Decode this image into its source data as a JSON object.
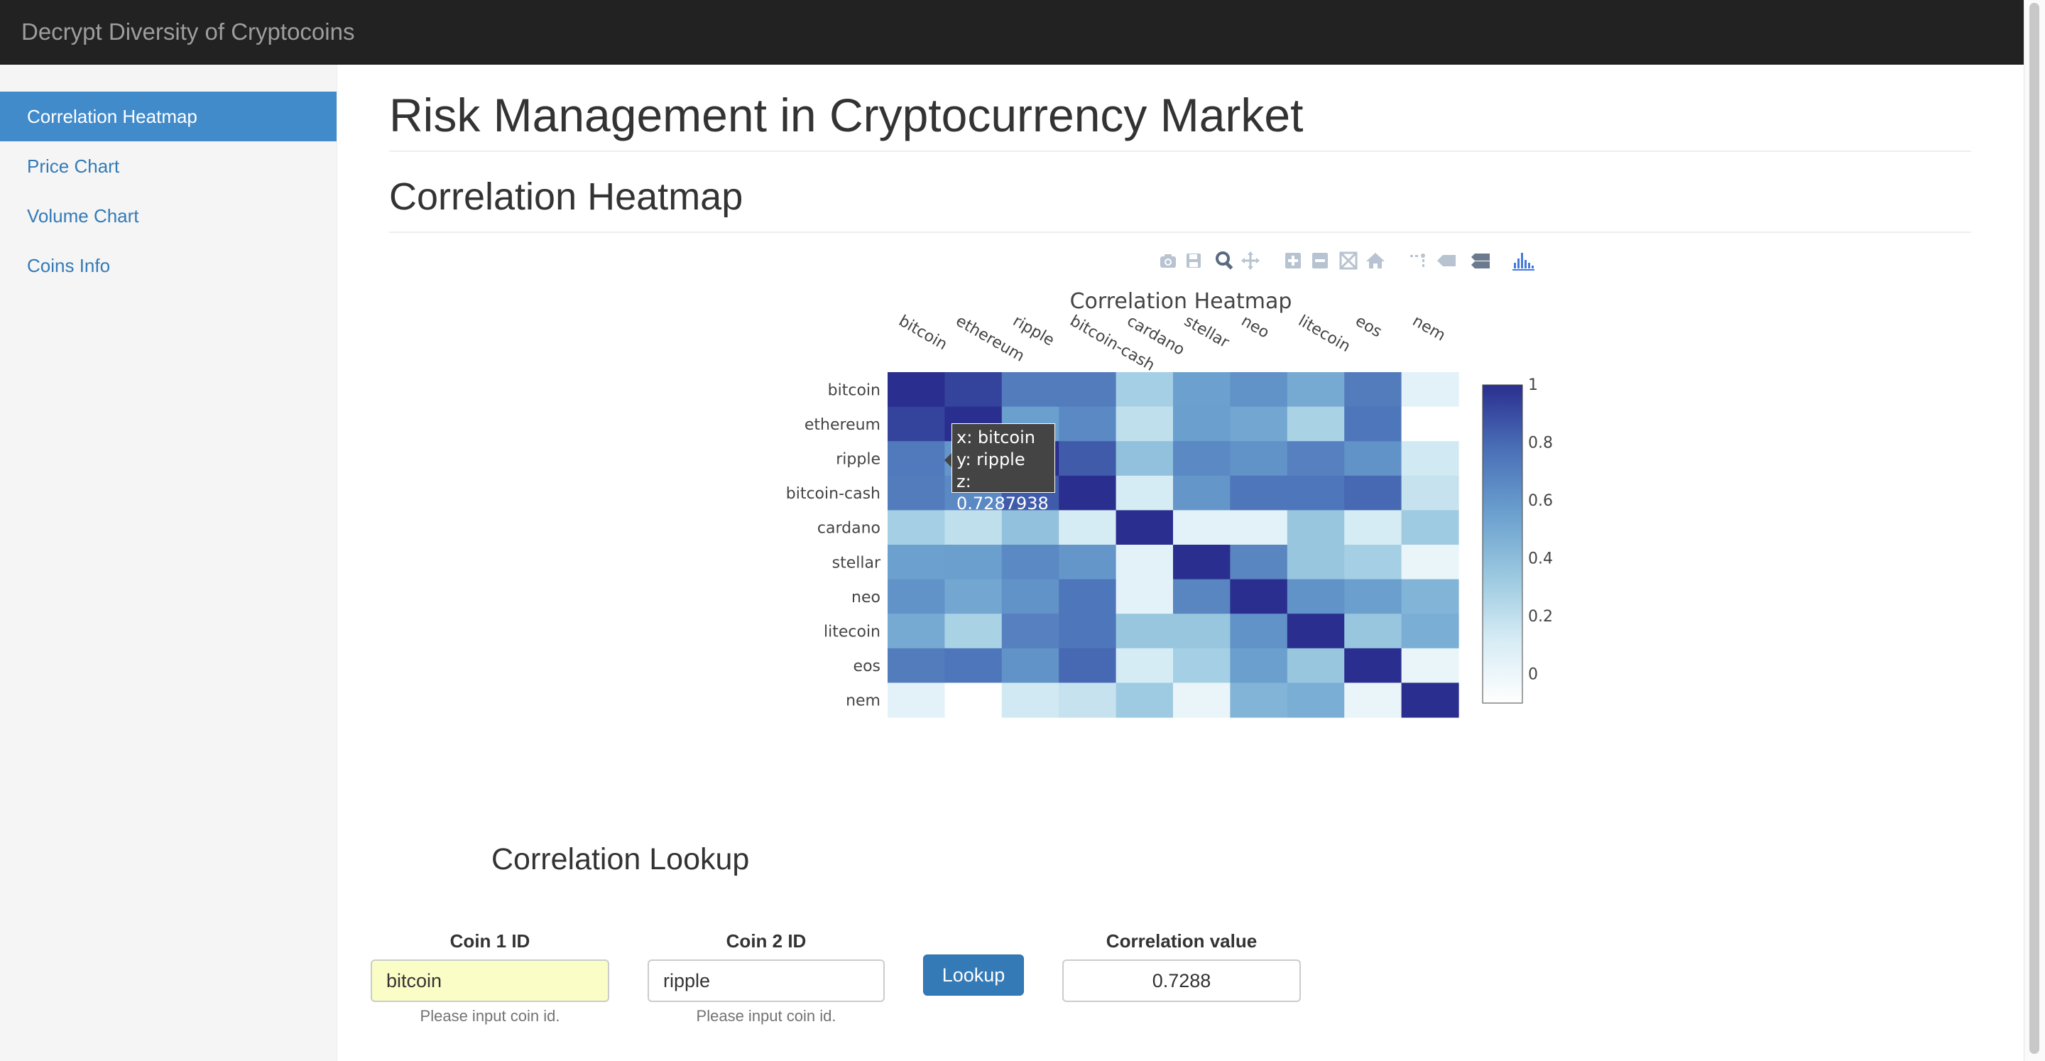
{
  "app": {
    "brand": "Decrypt Diversity of Cryptocoins"
  },
  "sidebar": {
    "items": [
      {
        "label": "Correlation Heatmap",
        "active": true
      },
      {
        "label": "Price Chart",
        "active": false
      },
      {
        "label": "Volume Chart",
        "active": false
      },
      {
        "label": "Coins Info",
        "active": false
      }
    ]
  },
  "main": {
    "title": "Risk Management in Cryptocurrency Market",
    "section_title": "Correlation Heatmap"
  },
  "modebar": {
    "icons": [
      "camera-icon",
      "save-icon",
      "zoom-icon",
      "pan-icon",
      "zoom-in-icon",
      "zoom-out-icon",
      "autoscale-icon",
      "home-icon",
      "spike-lines-icon",
      "hover-closest-icon",
      "hover-compare-icon",
      "plotly-logo-icon"
    ]
  },
  "chart_data": {
    "type": "heatmap",
    "title": "Correlation Heatmap",
    "x": [
      "bitcoin",
      "ethereum",
      "ripple",
      "bitcoin-cash",
      "cardano",
      "stellar",
      "neo",
      "litecoin",
      "eos",
      "nem"
    ],
    "y": [
      "bitcoin",
      "ethereum",
      "ripple",
      "bitcoin-cash",
      "cardano",
      "stellar",
      "neo",
      "litecoin",
      "eos",
      "nem"
    ],
    "z": [
      [
        1.0,
        0.93,
        0.72,
        0.72,
        0.3,
        0.55,
        0.62,
        0.5,
        0.72,
        0.05
      ],
      [
        0.93,
        1.0,
        0.56,
        0.66,
        0.2,
        0.56,
        0.52,
        0.28,
        0.75,
        -0.1
      ],
      [
        0.7287938,
        0.6,
        1.0,
        0.85,
        0.38,
        0.66,
        0.62,
        0.7,
        0.62,
        0.14
      ],
      [
        0.72,
        0.66,
        0.85,
        1.0,
        0.12,
        0.6,
        0.75,
        0.75,
        0.8,
        0.18
      ],
      [
        0.3,
        0.2,
        0.38,
        0.12,
        1.0,
        0.05,
        0.05,
        0.35,
        0.12,
        0.32
      ],
      [
        0.55,
        0.56,
        0.66,
        0.6,
        0.05,
        1.0,
        0.68,
        0.35,
        0.3,
        0.02
      ],
      [
        0.62,
        0.52,
        0.62,
        0.75,
        0.05,
        0.68,
        1.0,
        0.62,
        0.56,
        0.45
      ],
      [
        0.5,
        0.28,
        0.7,
        0.75,
        0.35,
        0.35,
        0.62,
        1.0,
        0.35,
        0.48
      ],
      [
        0.72,
        0.75,
        0.62,
        0.8,
        0.12,
        0.3,
        0.56,
        0.35,
        1.0,
        0.02
      ],
      [
        0.05,
        -0.1,
        0.14,
        0.18,
        0.32,
        0.02,
        0.45,
        0.48,
        0.02,
        1.0
      ]
    ],
    "zmin": -0.1,
    "zmax": 1,
    "colorbar_ticks": [
      "1",
      "0.8",
      "0.6",
      "0.4",
      "0.2",
      "0"
    ],
    "colorscale": [
      "#ffffff",
      "#d6ecf4",
      "#9ac8e0",
      "#6a9fce",
      "#4a6fb7",
      "#2a2f8f"
    ]
  },
  "tooltip": {
    "x": "x: bitcoin",
    "y": "y: ripple",
    "z": "z: 0.7287938"
  },
  "lookup": {
    "title": "Correlation Lookup",
    "coin1_label": "Coin 1 ID",
    "coin1_value": "bitcoin",
    "coin1_help": "Please input coin id.",
    "coin2_label": "Coin 2 ID",
    "coin2_value": "ripple",
    "coin2_help": "Please input coin id.",
    "button": "Lookup",
    "corr_label": "Correlation value",
    "corr_value": "0.7288"
  }
}
